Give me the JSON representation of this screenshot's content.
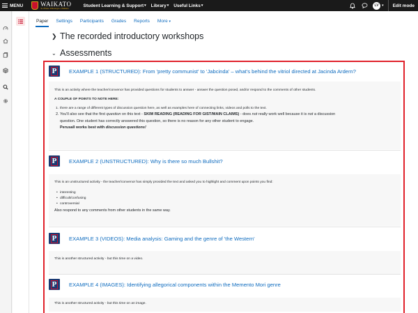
{
  "header": {
    "menu_label": "MENU",
    "logo_text": "WAIKATO",
    "logo_subtext": "Te Whare Wānanga o Waikato",
    "nav": [
      {
        "label": "Student Learning & Support"
      },
      {
        "label": "Library"
      },
      {
        "label": "Useful Links"
      }
    ],
    "avatar_initials": "LV",
    "edit_mode_label": "Edit mode"
  },
  "tabs": [
    {
      "label": "Paper",
      "active": true
    },
    {
      "label": "Settings"
    },
    {
      "label": "Participants"
    },
    {
      "label": "Grades"
    },
    {
      "label": "Reports"
    },
    {
      "label": "More"
    }
  ],
  "sections": {
    "recorded": "The recorded introductory workshops",
    "assessments": "Assessments"
  },
  "activities": {
    "ex1": {
      "title": "EXAMPLE 1 (STRUCTURED): From 'pretty communist' to 'Jabcinda' – what's behind the vitriol directed at Jacinda Ardern?",
      "desc_line": "This is an activity where the teacher/convenor has provided questions for students to answer - answer the question posed, and/or respond to the comments of other students.",
      "points_heading": "A COUPLE OF POINTS TO NOTE HERE:",
      "point1": "there are a range of different types of discussion question here, as well as examples here of connecting links, videos and polls to the text.",
      "point2_a": "You'll also see that the first",
      "point2_b": "question",
      "point2_c": "on this text -",
      "point2_d": "SKIM READING (READING FOR GIST/MAIN CLAIMS)",
      "point2_e": "- does",
      "point2_f": "not",
      "point2_g": "really work well because it is",
      "point2_h": "not",
      "point2_i": "a discussion",
      "point2_line2": "question. One student has correctly answered this question, so there is no reason for any other student to engage.",
      "point2_line3_a": "Perusall works best with",
      "point2_line3_b": "discussion questions!"
    },
    "ex2": {
      "title": "EXAMPLE 2 (UNSTRUCTURED): Why is there so much Bullshit?",
      "desc_line": "This is an unstructured activity - the teacher/convenor has simply provided the text and asked you to highlight and comment upon points you find:",
      "bullets": [
        "interesting",
        "difficult/confusing",
        "controversial"
      ],
      "respond": "Also respond to any comments from other students in the same way."
    },
    "ex3": {
      "title": "EXAMPLE 3 (VIDEOS): Media analysis: Gaming and the genre of 'the Western'",
      "desc_line": "This is another structured activity - but this time on a video."
    },
    "ex4": {
      "title": "EXAMPLE 4 (IMAGES): Identifying allegorical components within the Memento Mori genre",
      "desc_line": "This is another structured activity - but this time on an image."
    }
  },
  "icons": {
    "rail": [
      "dashboard-icon",
      "home-icon",
      "courses-icon",
      "cube-icon",
      "search-icon",
      "settings-icon"
    ],
    "perusall": "P"
  },
  "colors": {
    "link": "#0f6cbf",
    "highlight_border": "#e0202a",
    "perusall_blue": "#1b3a73",
    "topbar": "#1a1a1a"
  }
}
